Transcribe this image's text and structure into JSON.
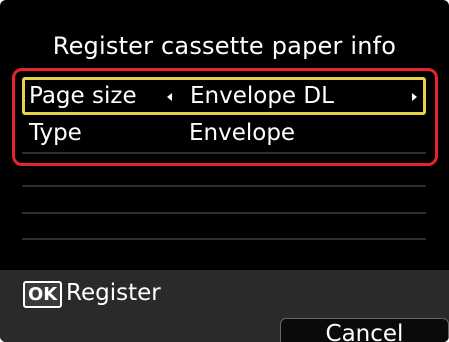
{
  "screen": {
    "title": "Register cassette paper info"
  },
  "settings": [
    {
      "label": "Page size",
      "value": "Envelope DL",
      "selected": true
    },
    {
      "label": "Type",
      "value": "Envelope",
      "selected": false
    }
  ],
  "footer": {
    "ok_key": "OK",
    "ok_label": "Register",
    "cancel_label": "Cancel"
  },
  "colors": {
    "background": "#000000",
    "selection_border": "#e6d24a",
    "annotation_border": "#e8232c",
    "footer_background": "#2a2a2a"
  },
  "icons": {
    "left_arrow": "triangle-left-icon",
    "right_arrow": "triangle-right-icon"
  }
}
